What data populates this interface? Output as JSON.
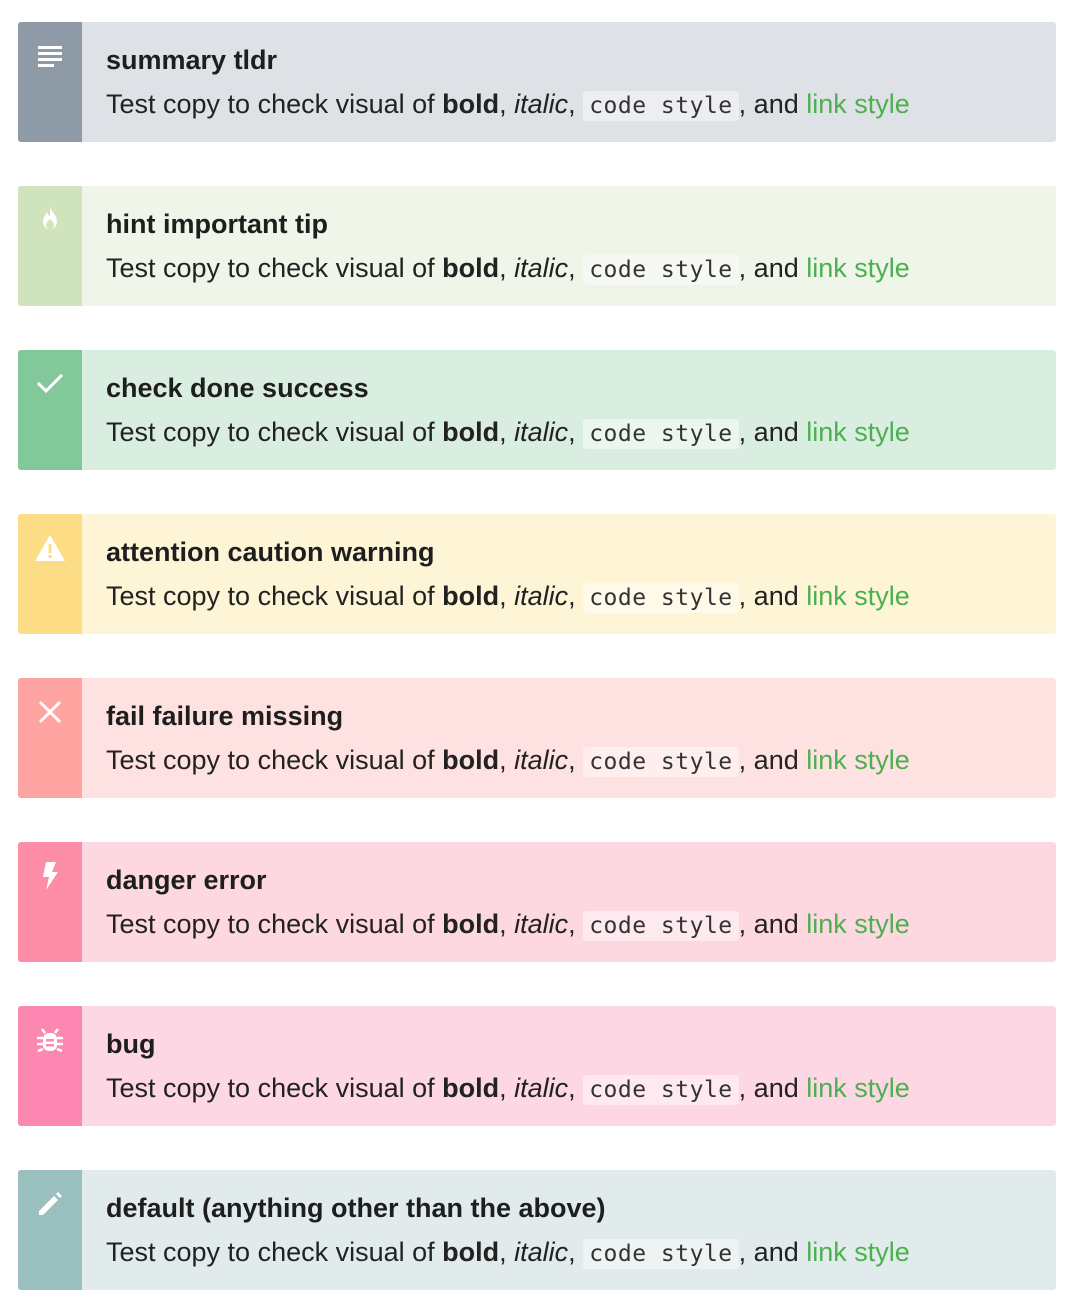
{
  "callouts": [
    {
      "icon": "list-icon",
      "title": "summary tldr",
      "side_color": "#8e9aa6",
      "bg_color": "#dee1e5"
    },
    {
      "icon": "flame-icon",
      "title": "hint important tip",
      "side_color": "#cfe4bc",
      "bg_color": "#eff5e9"
    },
    {
      "icon": "check-icon",
      "title": "check done success",
      "side_color": "#82c89a",
      "bg_color": "#d9eee1"
    },
    {
      "icon": "warning-icon",
      "title": "attention caution warning",
      "side_color": "#fcdc85",
      "bg_color": "#fef5d7"
    },
    {
      "icon": "close-icon",
      "title": "fail failure missing",
      "side_color": "#fda4a1",
      "bg_color": "#fee1e1"
    },
    {
      "icon": "bolt-icon",
      "title": "danger error",
      "side_color": "#fd8ca7",
      "bg_color": "#fdd8e0"
    },
    {
      "icon": "bug-icon",
      "title": "bug",
      "side_color": "#fc87b0",
      "bg_color": "#fdd7e4"
    },
    {
      "icon": "pencil-icon",
      "title": "default (anything other than the above)",
      "side_color": "#99c0bf",
      "bg_color": "#e1ebeb"
    }
  ],
  "copy": {
    "lead": "Test copy to check visual of ",
    "bold": "bold",
    "sep1": ", ",
    "italic": "italic",
    "sep2": ", ",
    "code": "code style",
    "sep3": ", and ",
    "link": "link style"
  },
  "colors": {
    "link": "#4caf50",
    "text": "#222222"
  }
}
